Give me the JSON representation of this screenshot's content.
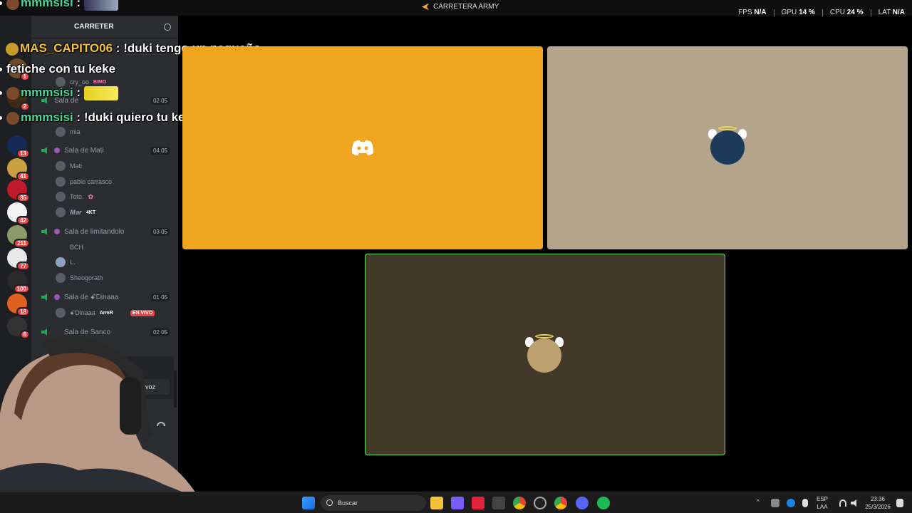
{
  "window": {
    "title": "CARRETERA ARMY"
  },
  "perf": {
    "fps_label": "FPS",
    "fps_value": "N/A",
    "gpu_label": "GPU",
    "gpu_value": "14 %",
    "cpu_label": "CPU",
    "cpu_value": "24 %",
    "lat_label": "LAT",
    "lat_value": "N/A"
  },
  "rail": {
    "badges": [
      "1",
      "2",
      "13",
      "41",
      "35",
      "42",
      "211",
      "77",
      "100",
      "18",
      "6"
    ]
  },
  "sidebar": {
    "server_name": "CARRETER",
    "voice_channels": [
      {
        "name": "Sala de",
        "count": "02",
        "limit": "05"
      },
      {
        "name": "Sala de Mati",
        "count": "04",
        "limit": "05"
      },
      {
        "name": "Sala de limitandolo",
        "count": "03",
        "limit": "05"
      },
      {
        "name": "Sala de ꗃDinaaa",
        "count": "01",
        "limit": "05"
      },
      {
        "name": "Sala de Sanco",
        "count": "02",
        "limit": "05"
      }
    ],
    "members": {
      "c0": [
        "cry_oo",
        "mia"
      ],
      "c0_tag": "BIMO",
      "c1": [
        "Mati",
        "pablo carrasco",
        "Toto.",
        "𝑴𝒂𝒓"
      ],
      "c1_tag": "4KT",
      "c2": [
        "BCH",
        "L.",
        "Sheogorath"
      ],
      "c3": [
        "ꗃDinaaa"
      ],
      "c3_tag": "ArmR",
      "live_label": "EN VIVO"
    },
    "voice_bar_label": "voz"
  },
  "chat": [
    {
      "user": "mmmsisi",
      "sep": " :",
      "text": ""
    },
    {
      "user": "MAS_CAPITO06",
      "sep": " :",
      "text": "!duki tengo un pequeño"
    },
    {
      "user": "",
      "sep": "",
      "text": "fetiche con tu keke"
    },
    {
      "user": "mmmsisi",
      "sep": " :",
      "text": ""
    },
    {
      "user": "mmmsisi",
      "sep": " :",
      "text": "!duki quiero tu keke en mi boca!"
    }
  ],
  "taskbar": {
    "search_placeholder": "Buscar",
    "lang_top": "ESP",
    "lang_bottom": "LAA",
    "time": "23:36",
    "date": "25/3/2026"
  },
  "colors": {
    "tile_a": "#f0a520",
    "tile_b": "#b3a48b",
    "tile_c": "#433929",
    "speaking_border": "#66e070",
    "chat_green": "#48d89a",
    "chat_yellow": "#f3c13a"
  }
}
